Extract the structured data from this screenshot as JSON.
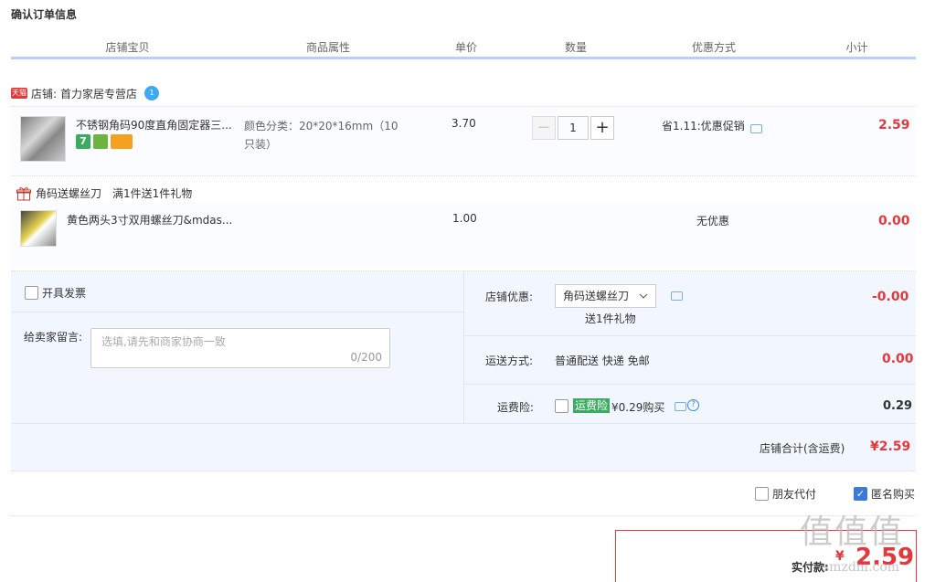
{
  "title": "确认订单信息",
  "columns": [
    "店铺宝贝",
    "商品属性",
    "单价",
    "数量",
    "优惠方式",
    "小计"
  ],
  "shop": {
    "badge": "天猫",
    "label": "店铺:",
    "name": "首力家居专营店",
    "ww_badge": "1"
  },
  "item1": {
    "name": "不锈钢角码90度直角固定器三...",
    "attr_line1": "颜色分类：20*20*16mm（10",
    "attr_line2": "只装）",
    "price": "3.70",
    "qty": "1",
    "qty_minus": "−",
    "qty_plus": "+",
    "promo": "省1.11:优惠促销",
    "subtotal": "2.59",
    "tag7": "7"
  },
  "gift": {
    "title": "角码送螺丝刀",
    "rule": "满1件送1件礼物",
    "name": "黄色两头3寸双用螺丝刀&mdas...",
    "price": "1.00",
    "promo": "无优惠",
    "subtotal": "0.00"
  },
  "invoice": {
    "label": "开具发票"
  },
  "message": {
    "label": "给卖家留言:",
    "placeholder": "选填,请先和商家协商一致",
    "counter": "0/200"
  },
  "shop_discount": {
    "label": "店铺优惠:",
    "select": "角码送螺丝刀",
    "sub": "送1件礼物",
    "amount": "-0.00"
  },
  "shipping": {
    "label": "运送方式:",
    "value": "普通配送 快递 免邮",
    "amount": "0.00"
  },
  "insurance": {
    "label": "运费险:",
    "tag": "运费险",
    "text": "¥0.29购买",
    "amount": "0.29"
  },
  "shop_total": {
    "label": "店铺合计(含运费)",
    "amount": "¥2.59"
  },
  "options": {
    "friend_pay": "朋友代付",
    "anonymous": "匿名购买",
    "anonymous_checked": true
  },
  "final": {
    "label": "实付款:",
    "currency": "¥",
    "amount": "2.59"
  },
  "watermark": {
    "logo": "值值值",
    "site": "smzdm.com"
  },
  "colors": {
    "accent_red": "#e4393c",
    "header_line": "#b2d1ff",
    "panel_bg": "#f2f7ff",
    "tag_green": "#3aab5f"
  }
}
